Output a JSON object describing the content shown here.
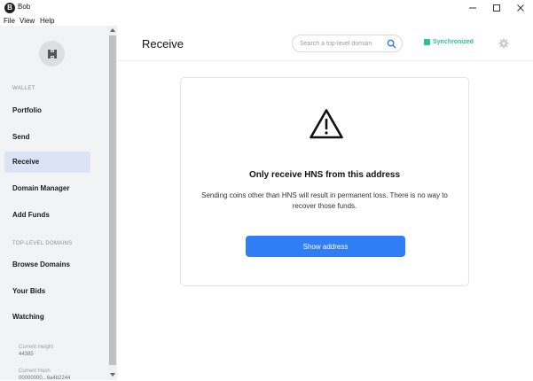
{
  "window": {
    "title": "Bob",
    "app_icon_letter": "B"
  },
  "menu": [
    {
      "label": "File"
    },
    {
      "label": "View"
    },
    {
      "label": "Help"
    }
  ],
  "sidebar": {
    "wallet_label": "WALLET",
    "wallet_items": [
      {
        "label": "Portfolio"
      },
      {
        "label": "Send"
      },
      {
        "label": "Receive",
        "active": true
      },
      {
        "label": "Domain Manager"
      },
      {
        "label": "Add Funds"
      }
    ],
    "domains_label": "TOP-LEVEL DOMAINS",
    "domain_items": [
      {
        "label": "Browse Domains"
      },
      {
        "label": "Your Bids"
      },
      {
        "label": "Watching"
      }
    ],
    "current_height_label": "Current Height",
    "current_height_value": "44385",
    "current_hash_label": "Current Hash",
    "current_hash_value": "00000000...6a4b2244"
  },
  "header": {
    "title": "Receive",
    "search_placeholder": "Search a top-level domain",
    "sync_status": "Synchronized"
  },
  "card": {
    "title": "Only receive HNS from this address",
    "body": "Sending coins other than HNS will result in permanent loss. There is no way to recover those funds.",
    "button_label": "Show address"
  },
  "colors": {
    "accent": "#2f7ef6",
    "sync": "#2cc28c",
    "sidebar_active": "#dbe3f4"
  }
}
